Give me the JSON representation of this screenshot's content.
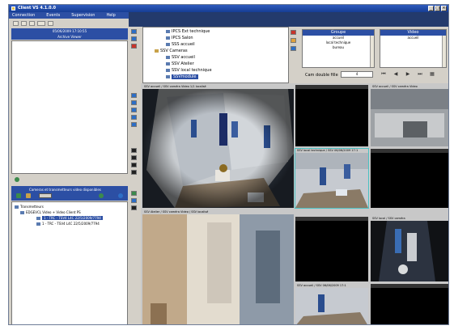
{
  "window": {
    "title": "Client VS 4.1.0.0",
    "buttons": [
      "_",
      "□",
      "×"
    ]
  },
  "menu": [
    "Connection",
    "Events",
    "Supervision",
    "Help"
  ],
  "left": {
    "date": "05/06/2009 17:10:55",
    "date_sub": "Archive Viewer",
    "cameras_header": "Cameras et transmetteurs video disponibles",
    "tree": [
      {
        "label": "Transmetteurs",
        "level": 0
      },
      {
        "label": "EDGEVCL Video + Video Client PS",
        "level": 1
      },
      {
        "label": "1 - TRC - TSV4 L4C 22/5/2009/7794",
        "level": 2,
        "selected": true
      },
      {
        "label": "1 - TRC - TSV4 L4C 22/5/2009/7794",
        "level": 2
      }
    ]
  },
  "camtree": [
    {
      "label": "IPCS Ext technique",
      "level": 1
    },
    {
      "label": "IPCS Salon",
      "level": 1
    },
    {
      "label": "SSS accueil",
      "level": 1
    },
    {
      "label": "SSV Cameras",
      "level": 0,
      "folder": true
    },
    {
      "label": "SSV accueil",
      "level": 1
    },
    {
      "label": "SSV Atelier",
      "level": 1
    },
    {
      "label": "SSV local technique",
      "level": 1
    },
    {
      "label": "SSVmodule",
      "level": 1,
      "selected": true
    }
  ],
  "groups": {
    "header": "Groupe",
    "items": [
      "accueil",
      "local technique",
      "bureau"
    ]
  },
  "views": {
    "header": "Video",
    "items": [
      "accueil"
    ]
  },
  "layout": {
    "label": "Cam double fille",
    "value": "4",
    "nav": [
      "⏮",
      "◀",
      "▶",
      "⏭",
      "▦"
    ]
  },
  "video_cells": [
    "SSV accueil / SSV caméra Video 1/1 localisé",
    "",
    "SSV accueil / SSV caméra Video",
    "",
    "SSV local technique / SSV 06/06/2009 17:1",
    "",
    "SSV Atelier / SSV caméra Video / SSV localisé",
    "",
    "SSV accueil / SSV 06/06/2009 17:1",
    "SSV local / SSV caméra",
    "",
    ""
  ]
}
